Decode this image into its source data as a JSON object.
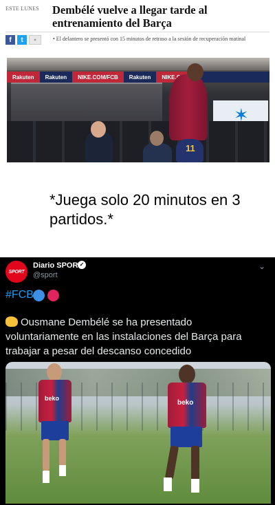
{
  "news": {
    "kicker": "ESTE LUNES",
    "headline": "Dembélé vuelve a llegar tarde al entrenamiento del Barça",
    "lede": "• El delantero se presentó con 15 minutos de retraso a la sesión de recuperación matinal",
    "share": {
      "facebook": "f",
      "twitter": "t"
    },
    "photo_texts": {
      "ad1": "Rakuten",
      "ad2": "Rakuten",
      "ad3": "NIKE.COM/FCB",
      "ad4": "Rakuten",
      "ad5": "NIKE.CO",
      "number": "11"
    }
  },
  "caption": "*Juega solo 20 minutos en 3 partidos.*",
  "tweet": {
    "avatar_text": "SPORT",
    "account_name": "Diario SPORT",
    "verified_mark": "✓",
    "handle": "@sport",
    "more": "⌄",
    "hashtag": "#FCB",
    "body": "Ousmane Dembélé se ha presentado voluntariamente en las instalaciones del Barça para trabajar a pesar del descanso concedido",
    "photo_texts": {
      "shirt1": "beko",
      "shirt2": "beko"
    }
  },
  "colors": {
    "fb": "#3b5998",
    "tw": "#1da1f2",
    "sport_red": "#e3051b",
    "link_blue": "#1d9bf0",
    "barca_red": "#a50044",
    "barca_blue": "#004d98"
  }
}
